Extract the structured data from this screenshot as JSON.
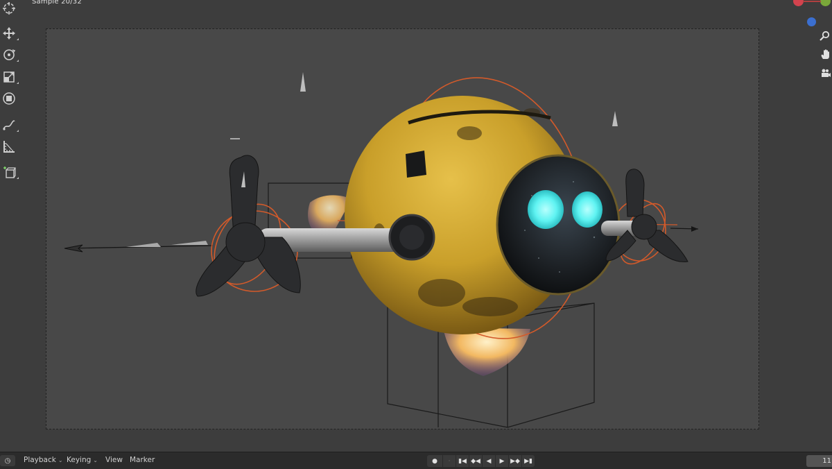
{
  "viewport": {
    "sample_label": "Sample 20/32"
  },
  "toolbar": {
    "tools": [
      {
        "name": "cursor-icon"
      },
      {
        "name": "move-icon"
      },
      {
        "name": "rotate-icon"
      },
      {
        "name": "scale-icon"
      },
      {
        "name": "transform-icon"
      },
      {
        "name": "annotate-icon"
      },
      {
        "name": "measure-icon"
      },
      {
        "name": "add-cube-icon"
      }
    ]
  },
  "navigation": {
    "buttons": [
      {
        "name": "zoom-icon"
      },
      {
        "name": "hand-icon"
      },
      {
        "name": "camera-icon"
      }
    ],
    "gizmo_colors": {
      "x": "#d2434e",
      "y": "#7aa83a",
      "z": "#3b6fd0"
    }
  },
  "scene": {
    "body_color": "#c9a12a",
    "eye_color": "#5ff3f2",
    "rig_color": "#d35a2a",
    "flame_color": "#f2b861"
  },
  "timeline": {
    "menus": {
      "playback": "Playback",
      "keying": "Keying",
      "view": "View",
      "marker": "Marker"
    },
    "current_frame": "11"
  }
}
